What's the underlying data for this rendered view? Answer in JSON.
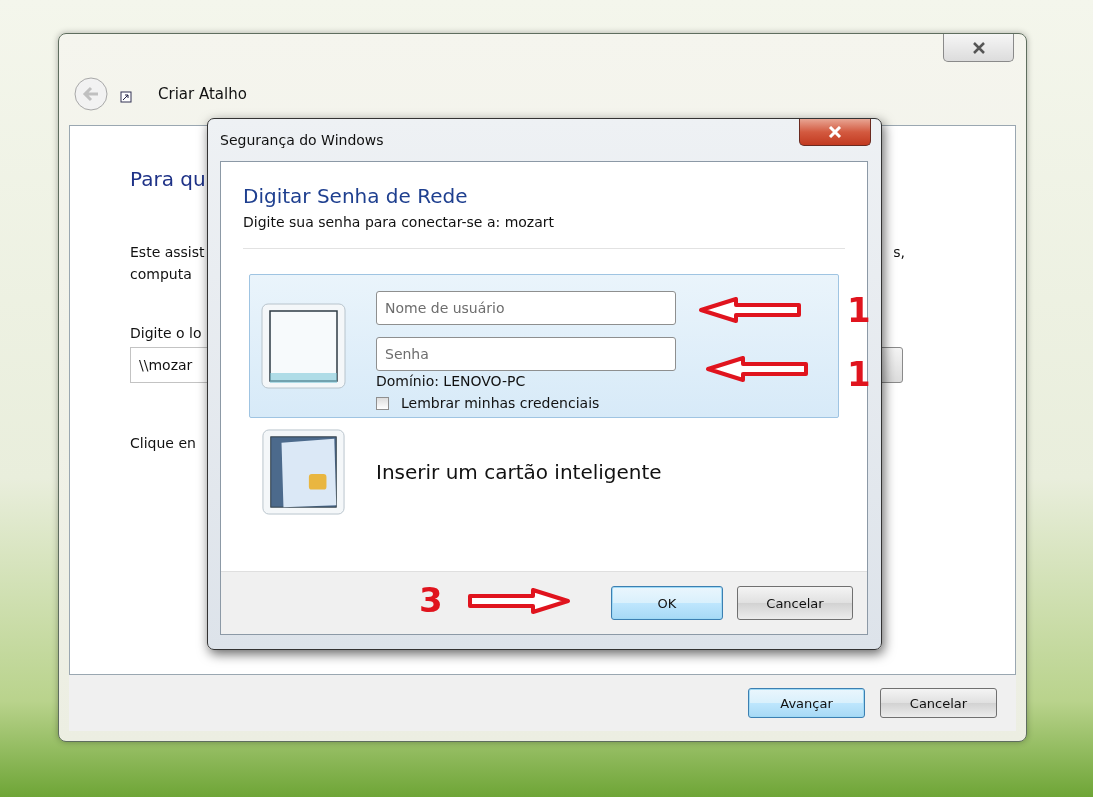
{
  "back_window": {
    "title": "Criar Atalho",
    "heading": "Para qu",
    "description_lines": [
      "Este assist",
      "computa"
    ],
    "description_tail": "s,",
    "location_label": "Digite o lo",
    "location_value": "\\\\mozar",
    "click_text": "Clique en",
    "buttons": [
      {
        "label": "Avançar",
        "default": true
      },
      {
        "label": "Cancelar",
        "default": false
      }
    ]
  },
  "dialog": {
    "title": "Segurança do Windows",
    "heading": "Digitar Senha de Rede",
    "subtitle": "Digite sua senha para conectar-se a: mozart",
    "credential_options": [
      {
        "kind": "password",
        "selected": true,
        "username_placeholder": "Nome de usuário",
        "password_placeholder": "Senha",
        "domain": "Domínio: LENOVO-PC",
        "remember": {
          "label": "Lembrar minhas credenciais",
          "checked": false
        }
      },
      {
        "kind": "smartcard",
        "selected": false,
        "label": "Inserir um cartão inteligente"
      }
    ],
    "buttons": [
      {
        "label": "OK",
        "default": true
      },
      {
        "label": "Cancelar",
        "default": false
      }
    ]
  },
  "annotations": [
    {
      "label": "1",
      "kind": "left"
    },
    {
      "label": "1",
      "kind": "left"
    },
    {
      "label": "3",
      "kind": "right"
    }
  ]
}
